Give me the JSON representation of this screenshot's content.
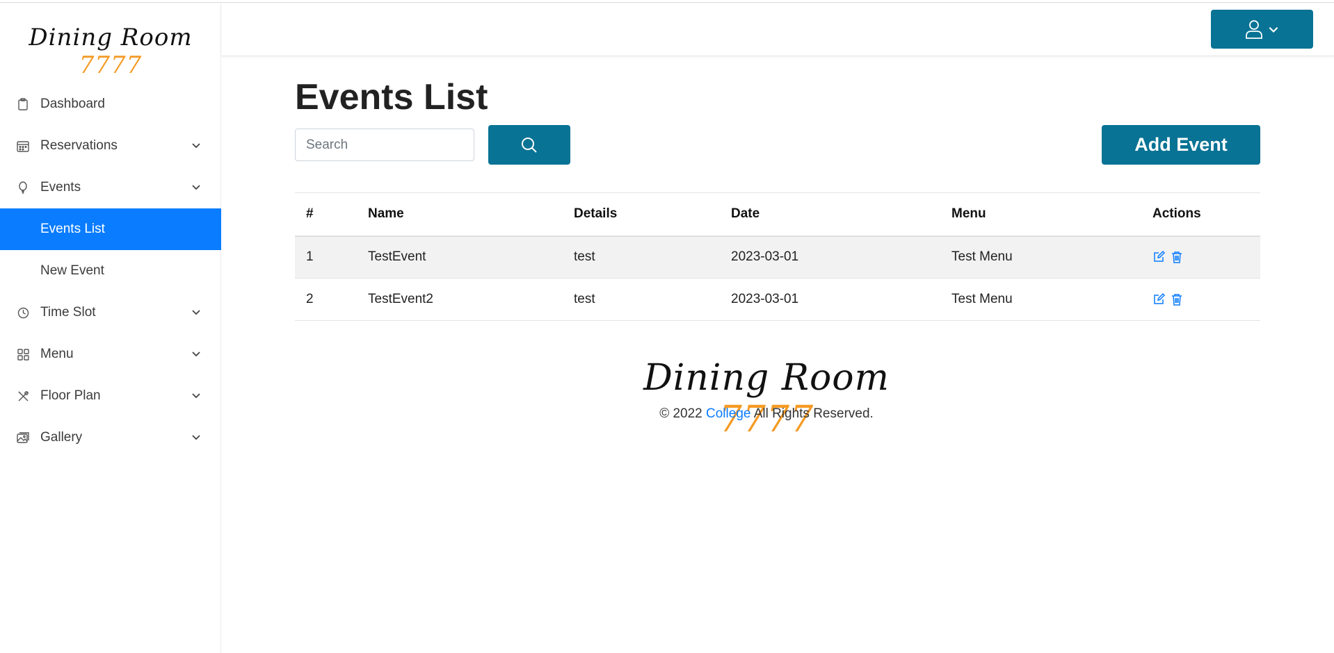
{
  "brand": {
    "name": "Dining Room",
    "number": "7777",
    "number_color": "#f59a23"
  },
  "sidebar": {
    "items": [
      {
        "label": "Dashboard",
        "icon": "clipboard-icon"
      },
      {
        "label": "Reservations",
        "icon": "calendar-icon"
      },
      {
        "label": "Events",
        "icon": "balloon-icon"
      },
      {
        "label": "Events List"
      },
      {
        "label": "New Event"
      },
      {
        "label": "Time Slot",
        "icon": "clock-icon"
      },
      {
        "label": "Menu",
        "icon": "grid-icon"
      },
      {
        "label": "Floor Plan",
        "icon": "utensils-icon"
      },
      {
        "label": "Gallery",
        "icon": "images-icon"
      }
    ],
    "active_color": "#0a7cff"
  },
  "header": {
    "user_icon": "user-icon"
  },
  "main": {
    "title": "Events List",
    "search_placeholder": "Search",
    "add_button": "Add Event",
    "accent_color": "#087394"
  },
  "table": {
    "headers": [
      "#",
      "Name",
      "Details",
      "Date",
      "Menu",
      "Actions"
    ],
    "rows": [
      {
        "num": "1",
        "name": "TestEvent",
        "details": "test",
        "date": "2023-03-01",
        "menu": "Test Menu"
      },
      {
        "num": "2",
        "name": "TestEvent2",
        "details": "test",
        "date": "2023-03-01",
        "menu": "Test Menu"
      }
    ]
  },
  "footer": {
    "copyright_prefix": "© 2022",
    "link": "College",
    "copyright_suffix": "All Rights Reserved."
  }
}
